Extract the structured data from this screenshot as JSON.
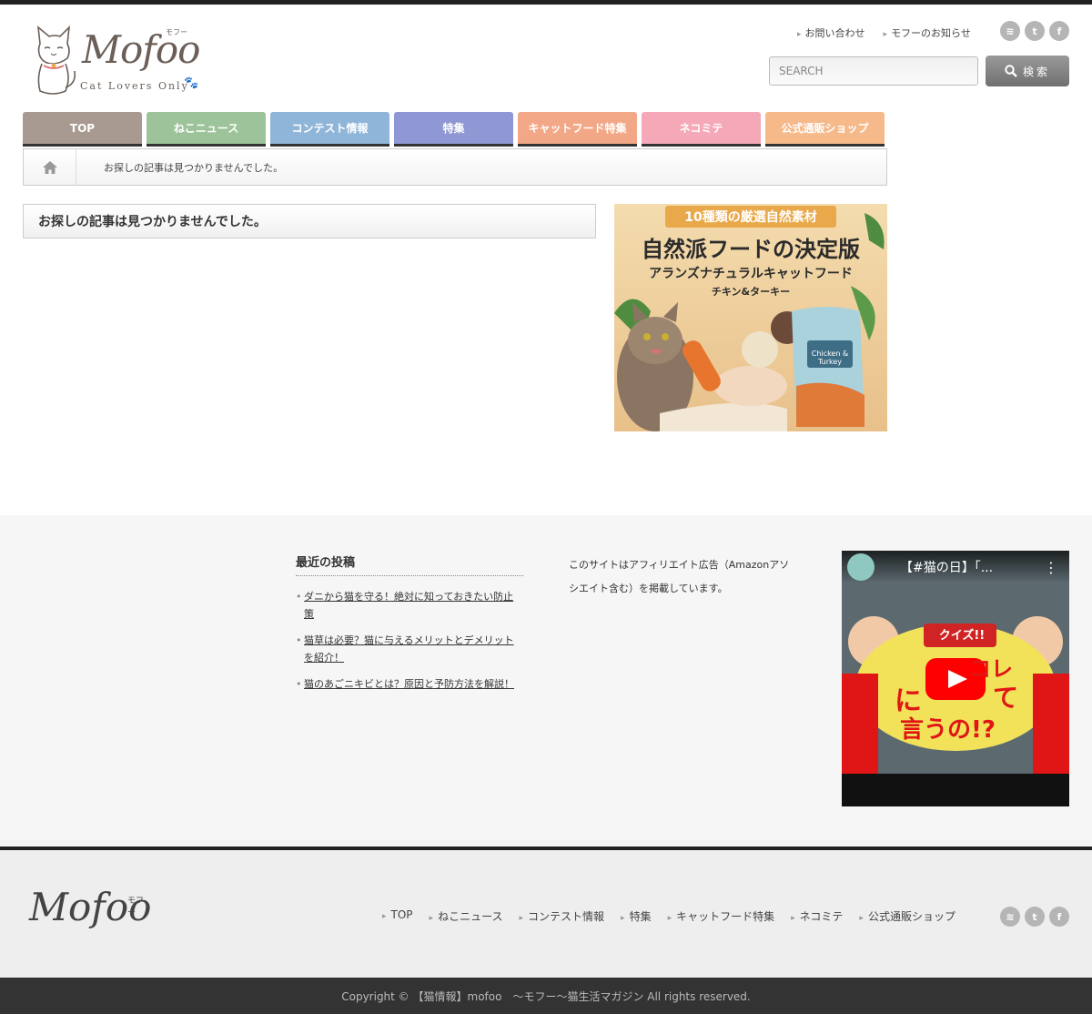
{
  "brand": {
    "name": "Mofoo",
    "kana": "モフー",
    "tagline": "Cat Lovers Only",
    "primary_color": "#6b5f58"
  },
  "header": {
    "links": [
      "お問い合わせ",
      "モフーのお知らせ"
    ],
    "social_icons": [
      "rss-icon",
      "twitter-icon",
      "facebook-icon"
    ],
    "search": {
      "placeholder": "SEARCH",
      "button_label": "検索"
    }
  },
  "nav": {
    "items": [
      {
        "label": "TOP",
        "color": "#a89a90"
      },
      {
        "label": "ねこニュース",
        "color": "#9cc39a"
      },
      {
        "label": "コンテスト情報",
        "color": "#8fb5d8"
      },
      {
        "label": "特集",
        "color": "#8f98d4"
      },
      {
        "label": "キャットフード特集",
        "color": "#f2a887"
      },
      {
        "label": "ネコミテ",
        "color": "#f5a9b8"
      },
      {
        "label": "公式通販ショップ",
        "color": "#f5b98a"
      }
    ]
  },
  "breadcrumb": {
    "current": "お探しの記事は見つかりませんでした。"
  },
  "main": {
    "title": "お探しの記事は見つかりませんでした。"
  },
  "ad": {
    "badge": "10種類の厳選自然素材",
    "headline": "自然派フードの決定版",
    "product": "アランズナチュラルキャットフード",
    "flavor": "チキン&ターキー",
    "bag_label": "Chicken & Turkey"
  },
  "widgets": {
    "recent_title": "最近の投稿",
    "recent_posts": [
      "ダニから猫を守る！絶対に知っておきたい防止策",
      "猫草は必要？猫に与えるメリットとデメリットを紹介！",
      "猫のあごニキビとは？原因と予防方法を解説！"
    ],
    "notice": "このサイトはアフィリエイト広告（Amazonアソシエイト含む）を掲載しています。",
    "video": {
      "title": "【#猫の日】「...",
      "overlay": [
        "クイズ!!",
        "コレ",
        "に",
        "て",
        "言うの!?"
      ]
    }
  },
  "footer": {
    "nav": [
      "TOP",
      "ねこニュース",
      "コンテスト情報",
      "特集",
      "キャットフード特集",
      "ネコミテ",
      "公式通販ショップ"
    ],
    "copyright": "Copyright ©  【猫情報】mofoo　～モフー～猫生活マガジン All rights reserved."
  }
}
